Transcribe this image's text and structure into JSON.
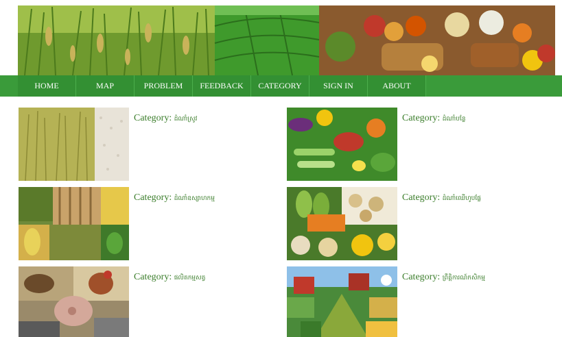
{
  "nav": {
    "items": [
      {
        "label": "HOME"
      },
      {
        "label": "MAP"
      },
      {
        "label": "PROBLEM"
      },
      {
        "label": "FEEDBACK"
      },
      {
        "label": "CATEGORY"
      },
      {
        "label": "SIGN IN"
      },
      {
        "label": "ABOUT"
      }
    ]
  },
  "categories": [
    {
      "prefix": "Category:",
      "name": "ដំណាំស្រូវ"
    },
    {
      "prefix": "Category:",
      "name": "ដំណាំបន្លែ"
    },
    {
      "prefix": "Category:",
      "name": "ដំណាំឧស្សាហកម្ម"
    },
    {
      "prefix": "Category:",
      "name": "ដំណាំឈើហូបផ្លែ"
    },
    {
      "prefix": "Category:",
      "name": "ផលិតកម្មសត្វ"
    },
    {
      "prefix": "Category:",
      "name": "ព្រឹត្តិការណ៍កសិកម្ម"
    }
  ],
  "colors": {
    "nav_bg": "#3a9b3a",
    "label_text": "#3a7d2a"
  }
}
